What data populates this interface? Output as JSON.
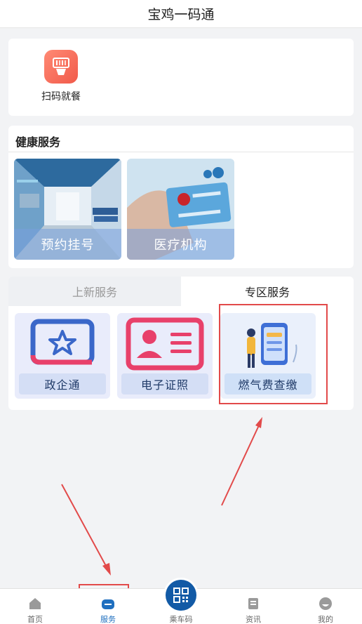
{
  "header": {
    "title": "宝鸡一码通"
  },
  "quick": {
    "scan_label": "扫码就餐"
  },
  "health": {
    "title": "健康服务",
    "tiles": [
      {
        "label": "预约挂号"
      },
      {
        "label": "医疗机构"
      }
    ]
  },
  "services": {
    "tabs": [
      {
        "label": "上新服务"
      },
      {
        "label": "专区服务"
      }
    ],
    "items": [
      {
        "label": "政企通"
      },
      {
        "label": "电子证照"
      },
      {
        "label": "燃气费查缴"
      }
    ]
  },
  "tabbar": {
    "items": [
      {
        "label": "首页"
      },
      {
        "label": "服务"
      },
      {
        "label": "乘车码"
      },
      {
        "label": "资讯"
      },
      {
        "label": "我的"
      }
    ]
  },
  "colors": {
    "accent": "#1f6fbf",
    "highlight": "#e24a4a",
    "brand_dark": "#125aa6"
  }
}
